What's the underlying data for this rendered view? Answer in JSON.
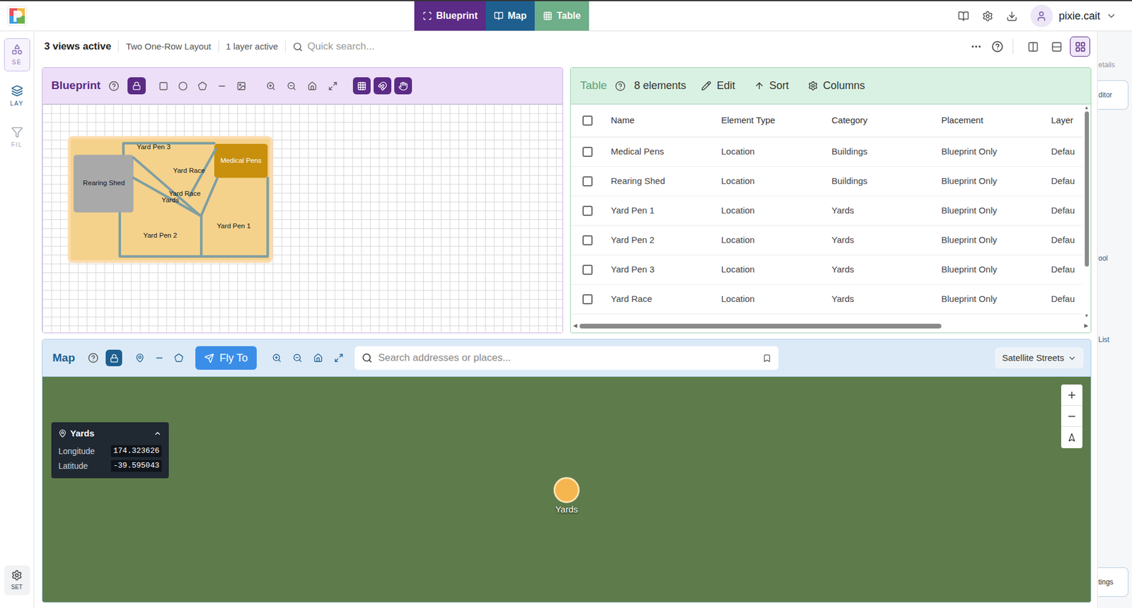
{
  "topbar": {
    "tabs": [
      {
        "label": "Blueprint",
        "selected": true,
        "color": "#5b2b86"
      },
      {
        "label": "Map",
        "selected": true,
        "color": "#1e5f8f"
      },
      {
        "label": "Table",
        "selected": true,
        "color": "#6eae88"
      }
    ],
    "user": "pixie.cait"
  },
  "sidebar": {
    "items": [
      {
        "label": "SE",
        "selected": true,
        "color": "#8c77b8"
      },
      {
        "label": "LAY",
        "selected": false,
        "color": "#1e5f8f"
      },
      {
        "label": "FIL",
        "selected": false,
        "color": "#a3aab3"
      }
    ],
    "settings": "SET"
  },
  "toolbar": {
    "views": "3 views active",
    "layout": "Two One-Row Layout",
    "layers": "1 layer active",
    "search_placeholder": "Quick search...",
    "layout_modes": [
      {
        "selected": false
      },
      {
        "selected": false
      },
      {
        "selected": true
      }
    ]
  },
  "blueprint": {
    "title": "Blueprint",
    "locked": true,
    "buildings": [
      {
        "label": "Rearing Shed",
        "color": "#a9a9a9"
      },
      {
        "label": "Medical Pens",
        "color": "#c8900c"
      }
    ],
    "labels": [
      "Yard Pen 3",
      "Yard Race",
      "Yard Race",
      "Yards",
      "Yard Pen 2",
      "Yard Pen 1"
    ]
  },
  "table": {
    "title": "Table",
    "count": "8 elements",
    "actions": [
      "Edit",
      "Sort",
      "Columns"
    ],
    "select_all": false,
    "columns": [
      "Name",
      "Element Type",
      "Category",
      "Placement",
      "Layer"
    ],
    "rows": [
      {
        "cells": [
          "Medical Pens",
          "Location",
          "Buildings",
          "Blueprint Only",
          "Defau"
        ],
        "checked": false
      },
      {
        "cells": [
          "Rearing Shed",
          "Location",
          "Buildings",
          "Blueprint Only",
          "Defau"
        ],
        "checked": false
      },
      {
        "cells": [
          "Yard Pen 1",
          "Location",
          "Yards",
          "Blueprint Only",
          "Defau"
        ],
        "checked": false
      },
      {
        "cells": [
          "Yard Pen 2",
          "Location",
          "Yards",
          "Blueprint Only",
          "Defau"
        ],
        "checked": false
      },
      {
        "cells": [
          "Yard Pen 3",
          "Location",
          "Yards",
          "Blueprint Only",
          "Defau"
        ],
        "checked": false
      },
      {
        "cells": [
          "Yard Race",
          "Location",
          "Yards",
          "Blueprint Only",
          "Defau"
        ],
        "checked": false
      }
    ],
    "scroll": {
      "horizontal": 0.72,
      "vertical": 0.77
    }
  },
  "map": {
    "title": "Map",
    "locked": true,
    "fly_to": "Fly To",
    "search_placeholder": "Search addresses or places...",
    "style": "Satellite Streets",
    "marker": {
      "label": "Yards"
    },
    "popup": {
      "title": "Yards",
      "expanded": true,
      "fields": [
        {
          "label": "Longitude",
          "value": "174.323626"
        },
        {
          "label": "Latitude",
          "value": "-39.595043"
        }
      ]
    }
  },
  "drawer": {
    "items": [
      {
        "label": "etails",
        "kind": "text",
        "color": "#8a96a3"
      },
      {
        "label": "ditor",
        "kind": "box",
        "color": "#1e5f8f"
      },
      {
        "label": "ool",
        "kind": "text",
        "color": "#1e5f8f"
      },
      {
        "label": "List",
        "kind": "text",
        "color": "#1e5f8f"
      },
      {
        "label": "tings",
        "kind": "box",
        "color": "#333333"
      }
    ]
  }
}
